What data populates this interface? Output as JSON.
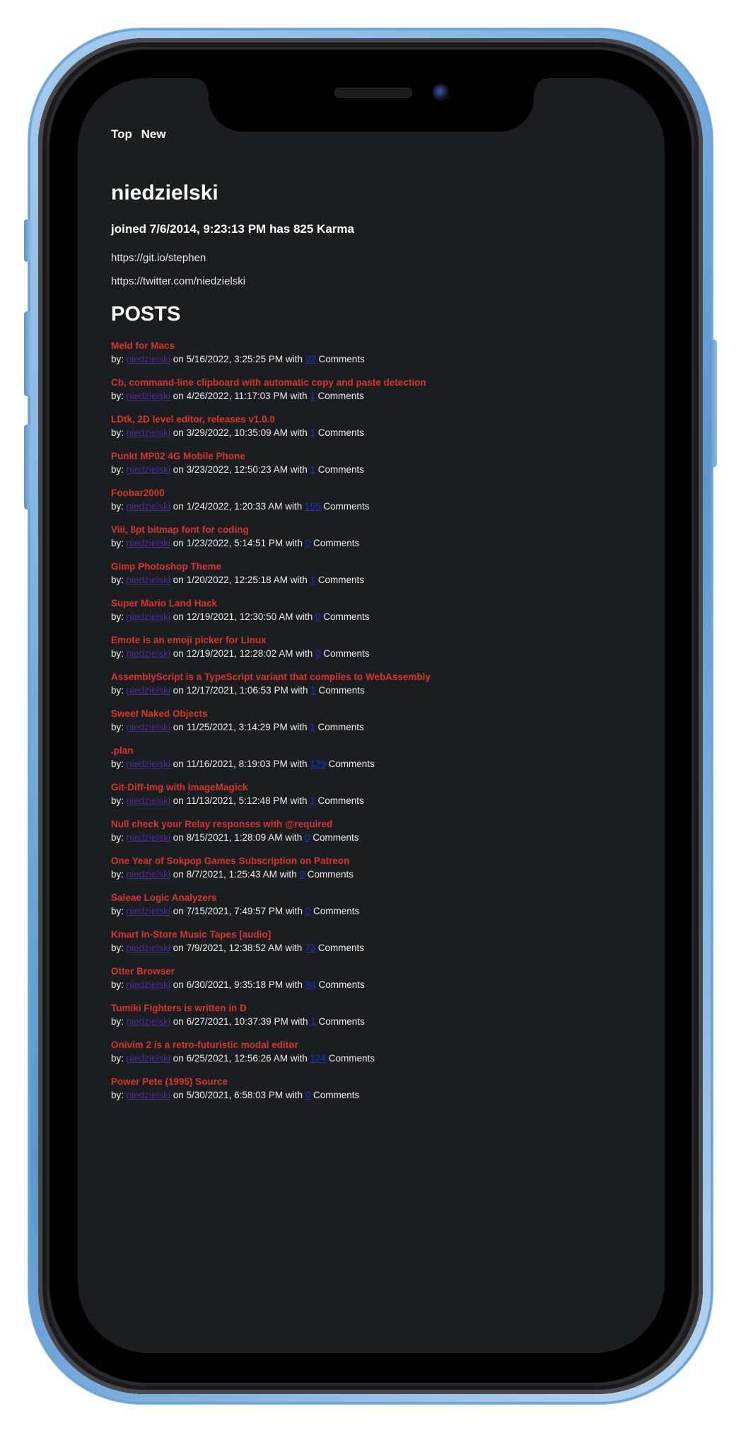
{
  "nav": {
    "top_label": "Top",
    "new_label": "New"
  },
  "profile": {
    "username": "niedzielski",
    "joined_text": "joined 7/6/2014, 9:23:13 PM has 825 Karma",
    "about_lines": [
      "https://git.io/stephen",
      "https://twitter.com/niedzielski"
    ]
  },
  "posts_heading": "POSTS",
  "posts": [
    {
      "title": "Meld for Macs",
      "author": "niedzielski",
      "date": "5/16/2022, 3:25:25 PM",
      "comments": "92"
    },
    {
      "title": "Cb, command-line clipboard with automatic copy and paste detection",
      "author": "niedzielski",
      "date": "4/26/2022, 11:17:03 PM",
      "comments": "1"
    },
    {
      "title": "LDtk, 2D level editor, releases v1.0.0",
      "author": "niedzielski",
      "date": "3/29/2022, 10:35:09 AM",
      "comments": "1"
    },
    {
      "title": "Punkt MP02 4G Mobile Phone",
      "author": "niedzielski",
      "date": "3/23/2022, 12:50:23 AM",
      "comments": "1"
    },
    {
      "title": "Foobar2000",
      "author": "niedzielski",
      "date": "1/24/2022, 1:20:33 AM",
      "comments": "155"
    },
    {
      "title": "Viii, 8pt bitmap font for coding",
      "author": "niedzielski",
      "date": "1/23/2022, 5:14:51 PM",
      "comments": "0"
    },
    {
      "title": "Gimp Photoshop Theme",
      "author": "niedzielski",
      "date": "1/20/2022, 12:25:18 AM",
      "comments": "1"
    },
    {
      "title": "Super Mario Land Hack",
      "author": "niedzielski",
      "date": "12/19/2021, 12:30:50 AM",
      "comments": "0"
    },
    {
      "title": "Emote is an emoji picker for Linux",
      "author": "niedzielski",
      "date": "12/19/2021, 12:28:02 AM",
      "comments": "0"
    },
    {
      "title": "AssemblyScript is a TypeScript variant that compiles to WebAssembly",
      "author": "niedzielski",
      "date": "12/17/2021, 1:06:53 PM",
      "comments": "1"
    },
    {
      "title": "Sweet Naked Objects",
      "author": "niedzielski",
      "date": "11/25/2021, 3:14:29 PM",
      "comments": "1"
    },
    {
      "title": ".plan",
      "author": "niedzielski",
      "date": "11/16/2021, 8:19:03 PM",
      "comments": "139"
    },
    {
      "title": "Git-Diff-Img with ImageMagick",
      "author": "niedzielski",
      "date": "11/13/2021, 5:12:48 PM",
      "comments": "1"
    },
    {
      "title": "Null check your Relay responses with @required",
      "author": "niedzielski",
      "date": "8/15/2021, 1:28:09 AM",
      "comments": "0"
    },
    {
      "title": "One Year of Sokpop Games Subscription on Patreon",
      "author": "niedzielski",
      "date": "8/7/2021, 1:25:43 AM",
      "comments": "0"
    },
    {
      "title": "Saleae Logic Analyzers",
      "author": "niedzielski",
      "date": "7/15/2021, 7:49:57 PM",
      "comments": "0"
    },
    {
      "title": "Kmart In-Store Music Tapes [audio]",
      "author": "niedzielski",
      "date": "7/9/2021, 12:38:52 AM",
      "comments": "73"
    },
    {
      "title": "Otter Browser",
      "author": "niedzielski",
      "date": "6/30/2021, 9:35:18 PM",
      "comments": "84"
    },
    {
      "title": "Tumiki Fighters is written in D",
      "author": "niedzielski",
      "date": "6/27/2021, 10:37:39 PM",
      "comments": "1"
    },
    {
      "title": "Onivim 2 is a retro-futuristic modal editor",
      "author": "niedzielski",
      "date": "6/25/2021, 12:56:26 AM",
      "comments": "124"
    },
    {
      "title": "Power Pete (1995) Source",
      "author": "niedzielski",
      "date": "5/30/2021, 6:58:03 PM",
      "comments": "0"
    }
  ],
  "meta_labels": {
    "by": "by: ",
    "on": " on ",
    "with": " with ",
    "comments_suffix": " Comments"
  },
  "colors": {
    "background": "#1b1e21",
    "title_red": "#d9342b",
    "author_purple": "#4a2a8f",
    "count_blue": "#1d2fbf",
    "text": "#e6e6e6"
  }
}
